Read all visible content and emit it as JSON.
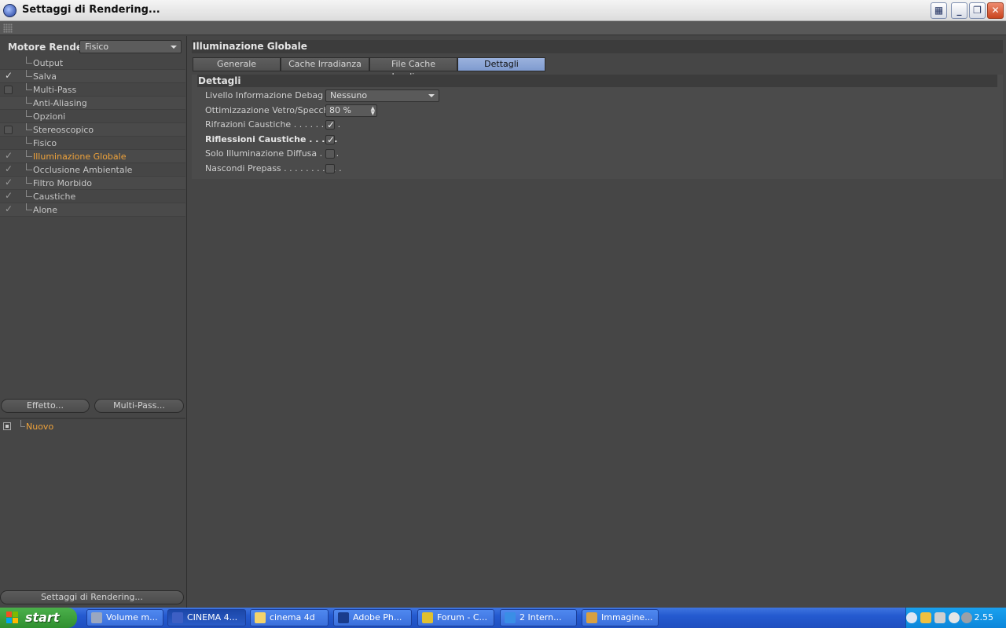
{
  "window": {
    "title": "Settaggi di Rendering...",
    "buttons": [
      "▦",
      "_",
      "❐",
      "✕"
    ]
  },
  "left": {
    "engine_label": "Motore Render",
    "engine_value": "Fisico",
    "tree": [
      {
        "label": "Output",
        "check": "none"
      },
      {
        "label": "Salva",
        "check": "tick"
      },
      {
        "label": "Multi-Pass",
        "check": "box"
      },
      {
        "label": "Anti-Aliasing",
        "check": "none"
      },
      {
        "label": "Opzioni",
        "check": "none"
      },
      {
        "label": "Stereoscopico",
        "check": "box"
      },
      {
        "label": "Fisico",
        "check": "none"
      },
      {
        "label": "Illuminazione Globale",
        "check": "tick-dim",
        "active": true
      },
      {
        "label": "Occlusione Ambientale",
        "check": "tick-dim"
      },
      {
        "label": "Filtro Morbido",
        "check": "tick-dim"
      },
      {
        "label": "Caustiche",
        "check": "tick-dim"
      },
      {
        "label": "Alone",
        "check": "tick-dim"
      }
    ],
    "effect_button": "Effetto...",
    "multipass_button": "Multi-Pass...",
    "effects": [
      {
        "label": "Nuovo"
      }
    ],
    "preset_button": "Settaggi di Rendering..."
  },
  "right": {
    "section_title": "Illuminazione Globale",
    "tabs": [
      {
        "label": "Generale"
      },
      {
        "label": "Cache Irradianza"
      },
      {
        "label": "File Cache Irradianza"
      },
      {
        "label": "Dettagli",
        "active": true
      }
    ],
    "group_title": "Dettagli",
    "rows": [
      {
        "label": "Livello Informazione Debag . . .",
        "type": "select",
        "value": "Nessuno"
      },
      {
        "label": "Ottimizzazione  Vetro/Specchio",
        "type": "number",
        "value": "80 %"
      },
      {
        "label": "Rifrazioni Caustiche . . . . . . . . .",
        "type": "check",
        "checked": true
      },
      {
        "label": "Riflessioni Caustiche  . . . . .",
        "type": "check",
        "checked": true,
        "bold": true
      },
      {
        "label": "Solo Illuminazione Diffusa  . . . .",
        "type": "check",
        "checked": false
      },
      {
        "label": "Nascondi Prepass . . . . . . . . . . .",
        "type": "check",
        "checked": false
      }
    ]
  },
  "taskbar": {
    "start_label": "start",
    "tasks": [
      {
        "label": "Volume m...",
        "icon_color": "#9aa7c0"
      },
      {
        "label": "CINEMA 4...",
        "icon_color": "#3d5fc4",
        "active": true
      },
      {
        "label": "cinema 4d",
        "icon_color": "#f3d36b"
      },
      {
        "label": "Adobe Ph...",
        "icon_color": "#1a3c8c"
      },
      {
        "label": "Forum - C...",
        "icon_color": "#e0c030"
      },
      {
        "label": "2 Intern...",
        "icon_color": "#3a8ee6"
      },
      {
        "label": "Immagine...",
        "icon_color": "#d8a040"
      }
    ],
    "clock": "2.55"
  },
  "colors": {
    "accent_orange": "#f0a33a",
    "active_tab": "#8ea7d6",
    "panel": "#464646"
  }
}
